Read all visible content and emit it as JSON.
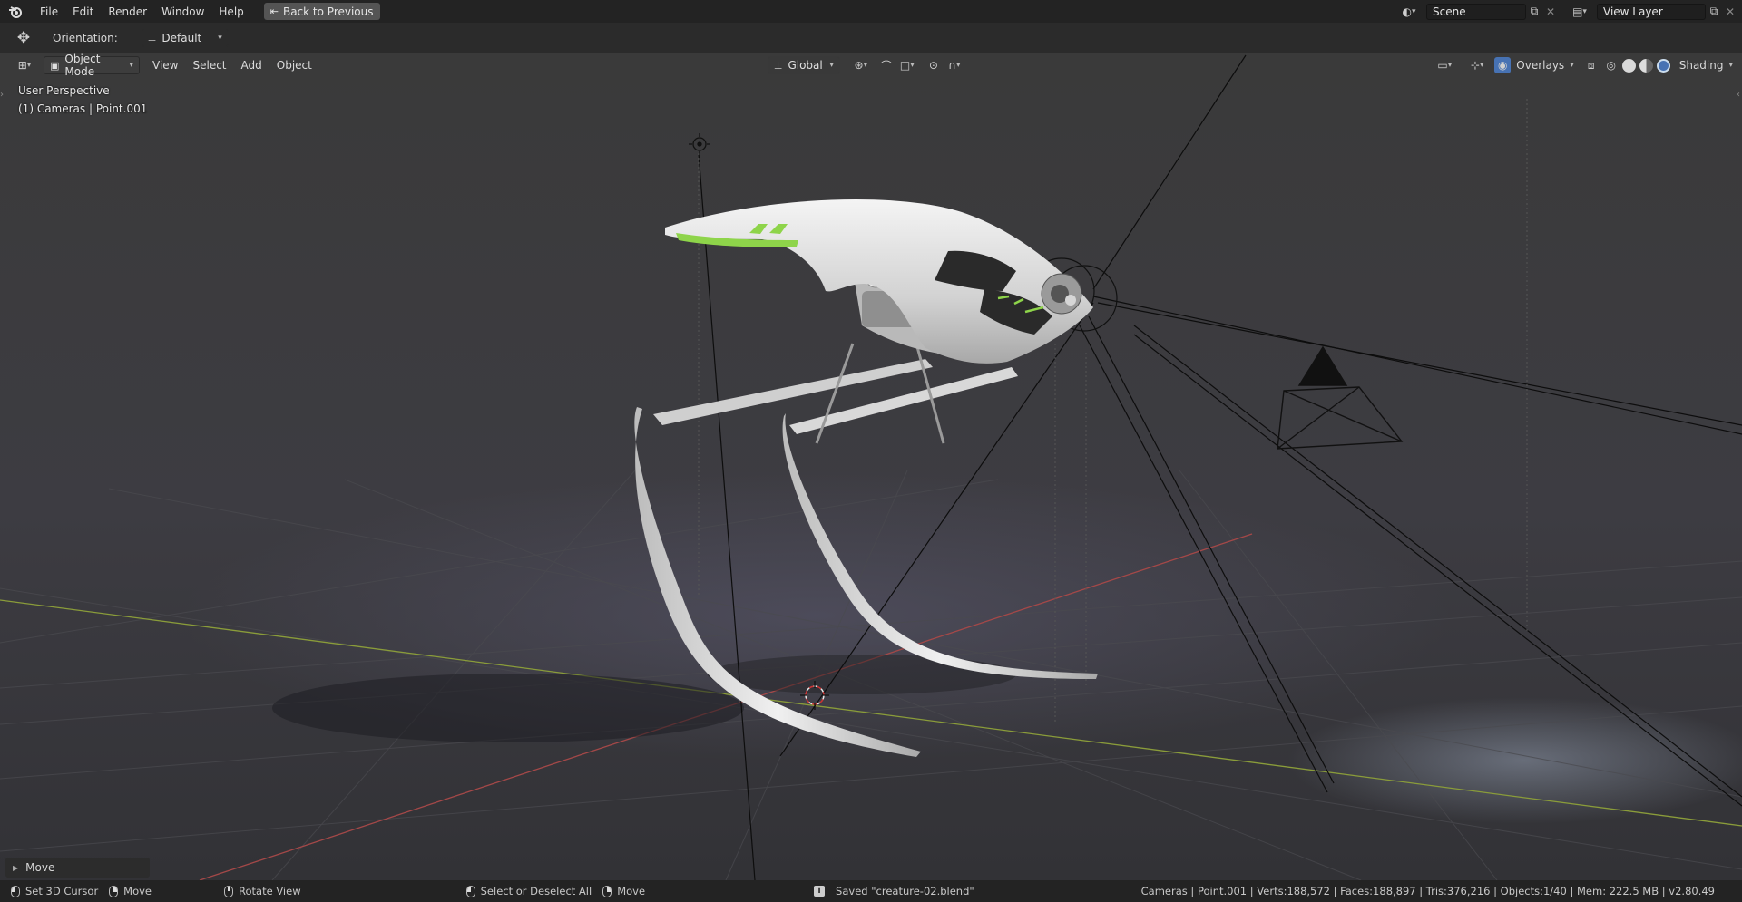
{
  "topbar": {
    "menus": [
      "File",
      "Edit",
      "Render",
      "Window",
      "Help"
    ],
    "back_button": "Back to Previous",
    "scene_label": "Scene",
    "view_layer_label": "View Layer"
  },
  "tool_settings": {
    "orientation_label": "Orientation:",
    "orientation_value": "Default"
  },
  "viewport_header": {
    "mode": "Object Mode",
    "menus": [
      "View",
      "Select",
      "Add",
      "Object"
    ],
    "transform_orientation": "Global",
    "overlays_label": "Overlays",
    "shading_label": "Shading"
  },
  "viewport": {
    "perspective_label": "User Perspective",
    "collection_label": "(1) Cameras | Point.001",
    "last_operator": "Move"
  },
  "statusbar": {
    "set_cursor": "Set 3D Cursor",
    "move_1": "Move",
    "rotate_view": "Rotate View",
    "select_all": "Select or Deselect All",
    "move_2": "Move",
    "saved_message": "Saved \"creature-02.blend\"",
    "stats": "Cameras | Point.001 | Verts:188,572 | Faces:188,897 | Tris:376,216 | Objects:1/40 | Mem: 222.5 MB | v2.80.49"
  },
  "colors": {
    "accent_blue": "#4772b3",
    "grid_x_axis": "#a44848",
    "grid_y_axis": "#8a9c3a",
    "creature_green": "#8ed44a"
  }
}
